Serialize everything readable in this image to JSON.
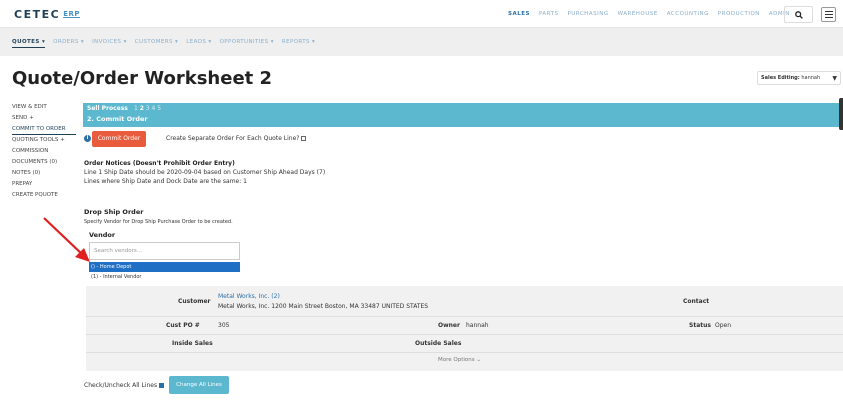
{
  "header": {
    "logo": "CETEC",
    "logo_suffix": "ERP",
    "nav": [
      "SALES",
      "PARTS",
      "PURCHASING",
      "WAREHOUSE",
      "ACCOUNTING",
      "PRODUCTION",
      "ADMIN"
    ],
    "active_nav": "SALES"
  },
  "subnav": {
    "items": [
      "QUOTES ▾",
      "ORDERS ▾",
      "INVOICES ▾",
      "CUSTOMERS ▾",
      "LEADS ▾",
      "OPPORTUNITIES ▾",
      "REPORTS ▾"
    ],
    "active": "QUOTES ▾"
  },
  "page": {
    "title": "Quote/Order Worksheet 2",
    "sales_editing_label": "Sales Editing:",
    "sales_editing_value": "hannah"
  },
  "sidemenu": {
    "items": [
      "VIEW & EDIT",
      "SEND +",
      "COMMIT TO ORDER",
      "QUOTING TOOLS +",
      "COMMISSION",
      "DOCUMENTS (0)",
      "NOTES (0)",
      "PREPAY",
      "CREATE PQUOTE"
    ],
    "active": "COMMIT TO ORDER"
  },
  "sell_process": {
    "label": "Sell Process",
    "steps": [
      "1",
      "2",
      "3",
      "4",
      "5"
    ],
    "current_step": "2",
    "subtitle": "2. Commit Order"
  },
  "commit": {
    "button": "Commit Order",
    "separate_label": "Create Separate Order For Each Quote Line?"
  },
  "notices": {
    "heading": "Order Notices (Doesn't Prohibit Order Entry)",
    "line1": "Line 1 Ship Date should be 2020-09-04 based on Customer Ship Ahead Days (7)",
    "line2": "Lines where Ship Date and Dock Date are the same: 1"
  },
  "dropship": {
    "heading": "Drop Ship Order",
    "sub": "Specify Vendor for Drop Ship Purchase Order to be created.",
    "vendor_label": "Vendor",
    "search_placeholder": "Search vendors...",
    "options": [
      "() - Home Depot",
      "(1) - Internal Vendor"
    ],
    "selected_index": 0
  },
  "info": {
    "customer_label": "Customer",
    "customer_name": "Metal Works, Inc. (2)",
    "customer_address": "Metal Works, Inc. 1200 Main Street Boston, MA 33487 UNITED STATES",
    "contact_label": "Contact",
    "custpo_label": "Cust PO #",
    "custpo_value": "305",
    "owner_label": "Owner",
    "owner_value": "hannah",
    "status_label": "Status",
    "status_value": "Open",
    "inside_sales_label": "Inside Sales",
    "outside_sales_label": "Outside Sales",
    "more_options": "More Options ⌄"
  },
  "lines": {
    "check_label": "Check/Uncheck All Lines",
    "change_button": "Change All Lines"
  },
  "colors": {
    "accent": "#5bb8cf",
    "commit": "#e85b3c",
    "link": "#2a6fa8",
    "selected": "#1f6fc4",
    "arrow": "#e02020"
  }
}
